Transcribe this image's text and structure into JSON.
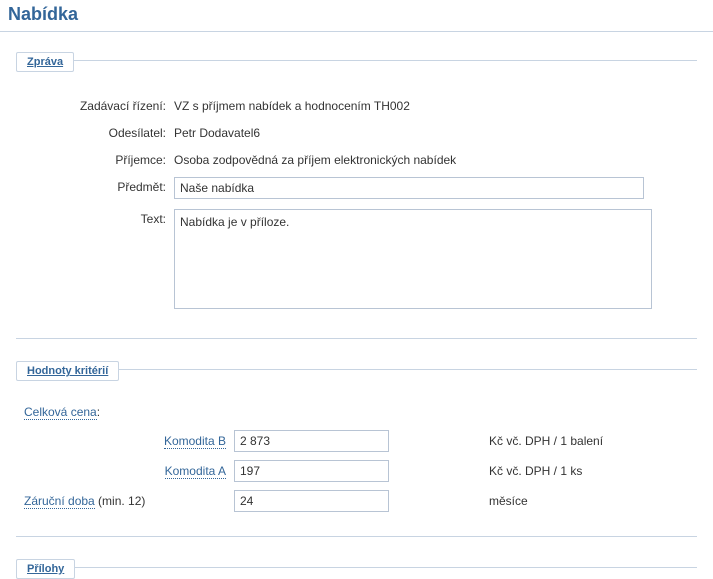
{
  "page": {
    "title": "Nabídka"
  },
  "zprava": {
    "legend": "Zpráva",
    "labels": {
      "zadavaci_rizeni": "Zadávací řízení:",
      "odesilatel": "Odesílatel:",
      "prijemce": "Příjemce:",
      "predmet": "Předmět:",
      "text": "Text:"
    },
    "values": {
      "zadavaci_rizeni": "VZ s příjmem nabídek a hodnocením TH002",
      "odesilatel": "Petr Dodavatel6",
      "prijemce": "Osoba zodpovědná za příjem elektronických nabídek",
      "predmet": "Naše nabídka",
      "text": "Nabídka je v příloze."
    }
  },
  "hodnoty": {
    "legend": "Hodnoty kritérií",
    "celkova_cena_label": "Celková cena",
    "rows": [
      {
        "label": "Komodita B",
        "link": true,
        "value": "2 873",
        "unit": "Kč vč. DPH / 1 balení"
      },
      {
        "label": "Komodita A",
        "link": true,
        "value": "197",
        "unit": "Kč vč. DPH / 1 ks"
      }
    ],
    "zarucni": {
      "label": "Záruční doba",
      "suffix": " (min. 12)",
      "value": "24",
      "unit": "měsíce"
    }
  },
  "prilohy": {
    "legend": "Přílohy"
  }
}
